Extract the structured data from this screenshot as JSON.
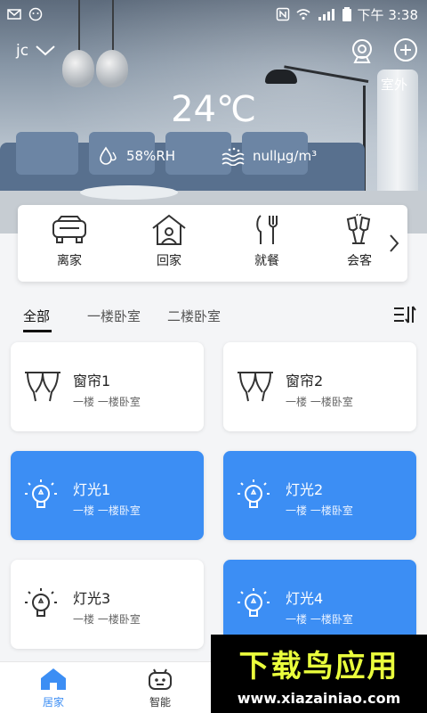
{
  "status_bar": {
    "time": "下午 3:38"
  },
  "header": {
    "home_name": "jc",
    "outdoor_label": "室外",
    "temperature": "24℃",
    "humidity": "58%RH",
    "pm": "nullμg/m³"
  },
  "scenes": [
    {
      "label": "离家",
      "icon": "car-icon"
    },
    {
      "label": "回家",
      "icon": "home-icon"
    },
    {
      "label": "就餐",
      "icon": "cutlery-icon"
    },
    {
      "label": "会客",
      "icon": "wine-glasses-icon"
    }
  ],
  "tabs": [
    {
      "label": "全部"
    },
    {
      "label": "一楼卧室"
    },
    {
      "label": "二楼卧室"
    }
  ],
  "devices": [
    {
      "name": "窗帘1",
      "room": "一楼 一楼卧室",
      "icon": "curtain-icon",
      "on": false
    },
    {
      "name": "窗帘2",
      "room": "一楼 一楼卧室",
      "icon": "curtain-icon",
      "on": false
    },
    {
      "name": "灯光1",
      "room": "一楼 一楼卧室",
      "icon": "bulb-icon",
      "on": true
    },
    {
      "name": "灯光2",
      "room": "一楼 一楼卧室",
      "icon": "bulb-icon",
      "on": true
    },
    {
      "name": "灯光3",
      "room": "一楼 一楼卧室",
      "icon": "bulb-icon",
      "on": false
    },
    {
      "name": "灯光4",
      "room": "一楼 一楼卧室",
      "icon": "bulb-icon",
      "on": true
    }
  ],
  "bottom_nav": [
    {
      "label": "居家",
      "icon": "house-icon",
      "active": true
    },
    {
      "label": "智能",
      "icon": "robot-icon",
      "active": false
    }
  ],
  "watermark": {
    "title": "下载鸟应用",
    "url": "www.xiazainiao.com"
  },
  "colors": {
    "accent": "#3c8ef4",
    "card_on": "#3c8ef4",
    "card_off": "#ffffff"
  }
}
